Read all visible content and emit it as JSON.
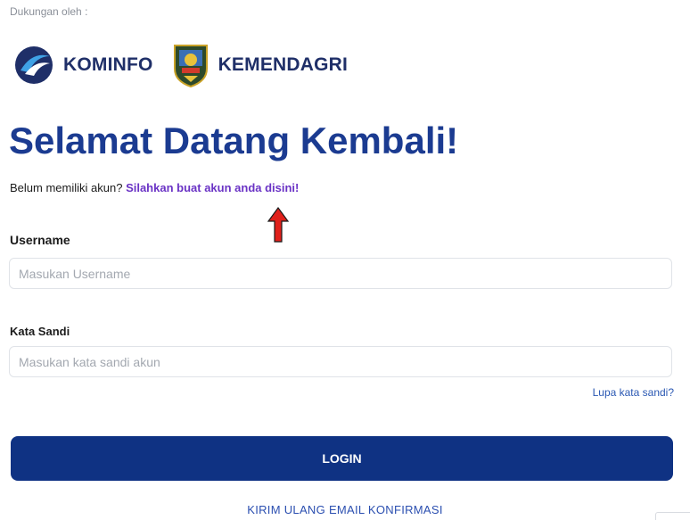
{
  "header": {
    "supported_by": "Dukungan oleh :",
    "logos": [
      {
        "name": "KOMINFO",
        "icon": "kominfo-logo"
      },
      {
        "name": "KEMENDAGRI",
        "icon": "kemendagri-emblem"
      }
    ]
  },
  "main": {
    "title": "Selamat Datang Kembali!",
    "no_account_text": "Belum memiliki akun?",
    "register_link": "Silahkan buat akun anda disini!",
    "annotation_icon": "red-up-arrow-icon"
  },
  "form": {
    "username_label": "Username",
    "username_placeholder": "Masukan Username",
    "username_value": "",
    "password_label": "Kata Sandi",
    "password_placeholder": "Masukan kata sandi akun",
    "password_value": "",
    "forgot_link": "Lupa kata sandi?",
    "login_button": "LOGIN",
    "resend_link": "KIRIM ULANG EMAIL KONFIRMASI"
  },
  "colors": {
    "brand_blue": "#0f3283",
    "title_blue": "#1b3b91",
    "link_purple": "#6a33c5",
    "arrow_red": "#e0201b"
  }
}
